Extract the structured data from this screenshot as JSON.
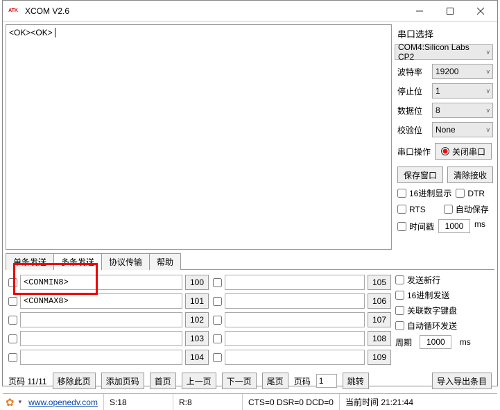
{
  "window": {
    "title": "XCOM V2.6",
    "logo": "ATK"
  },
  "rx_text": "<OK><OK>",
  "side": {
    "header": "串口选择",
    "port": "COM4:Silicon Labs CP2",
    "baud_label": "波特率",
    "baud": "19200",
    "stop_label": "停止位",
    "stop": "1",
    "data_label": "数据位",
    "data": "8",
    "parity_label": "校验位",
    "parity": "None",
    "op_label": "串口操作",
    "op_btn": "关闭串口",
    "save_win": "保存窗口",
    "clear_rx": "清除接收",
    "hex_disp": "16进制显示",
    "dtr": "DTR",
    "rts": "RTS",
    "autosave": "自动保存",
    "timestamp": "时间戳",
    "ts_val": "1000",
    "ms": "ms"
  },
  "tabs": [
    "单条发送",
    "多条发送",
    "协议传输",
    "帮助"
  ],
  "multi": {
    "left": [
      {
        "txt": "<CONMIN8>",
        "n": "100"
      },
      {
        "txt": "<CONMAX8>",
        "n": "101"
      },
      {
        "txt": "",
        "n": "102"
      },
      {
        "txt": "",
        "n": "103"
      },
      {
        "txt": "",
        "n": "104"
      }
    ],
    "right": [
      {
        "txt": "",
        "n": "105"
      },
      {
        "txt": "",
        "n": "106"
      },
      {
        "txt": "",
        "n": "107"
      },
      {
        "txt": "",
        "n": "108"
      },
      {
        "txt": "",
        "n": "109"
      }
    ]
  },
  "opts": {
    "newline": "发送新行",
    "hex_send": "16进制发送",
    "numpad": "关联数字键盘",
    "loop": "自动循环发送",
    "period_label": "周期",
    "period": "1000",
    "ms": "ms"
  },
  "pager": {
    "page_label": "页码 11/11",
    "remove": "移除此页",
    "add": "添加页码",
    "first": "首页",
    "prev": "上一页",
    "next": "下一页",
    "last": "尾页",
    "pg_lbl": "页码",
    "pg_val": "1",
    "jump": "跳转",
    "impexp": "导入导出条目"
  },
  "status": {
    "url": "www.openedv.com",
    "s": "S:18",
    "r": "R:8",
    "cts": "CTS=0 DSR=0 DCD=0",
    "time": "当前时间 21:21:44"
  }
}
